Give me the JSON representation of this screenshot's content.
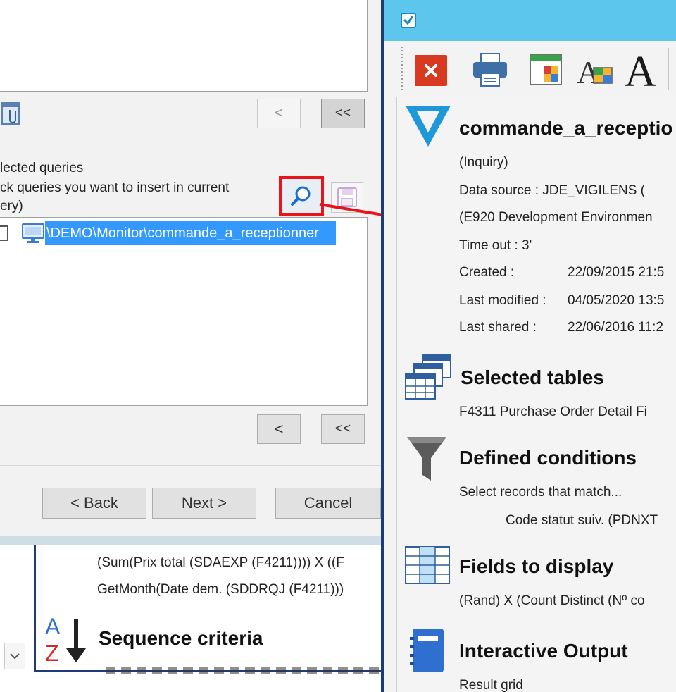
{
  "wizard": {
    "back_small": "<",
    "back_all": "<<",
    "section_title": "lected queries",
    "section_desc_line1": "ck queries you want to insert in current",
    "section_desc_line2": "ery)",
    "query_path": "\\DEMO\\Monitor\\commande_a_receptionner",
    "nav_back_small": "<",
    "nav_back_all": "<<",
    "back_button": "< Back",
    "next_button": "Next >",
    "cancel_button": "Cancel"
  },
  "behind_panel": {
    "line1": "(Sum(Prix total (SDAEXP (F4211)))) X ((F",
    "line2": "GetMonth(Date dem. (SDDRQJ (F4211)))",
    "sequence_heading": "Sequence criteria"
  },
  "report": {
    "query_title": "commande_a_receptio",
    "type": "(Inquiry)",
    "data_source": "Data source : JDE_VIGILENS   (",
    "environment": "(E920 Development Environmen",
    "timeout": "Time out : 3'",
    "created_label": "Created :",
    "created_value": "22/09/2015 21:5",
    "modified_label": "Last modified :",
    "modified_value": "04/05/2020 13:5",
    "shared_label": "Last shared :",
    "shared_value": "22/06/2016 11:2",
    "selected_tables_heading": "Selected tables",
    "selected_tables_value": "F4311  Purchase Order Detail Fi",
    "conditions_heading": "Defined conditions",
    "conditions_line1": "Select records that match...",
    "conditions_line2": "Code statut suiv. (PDNXT",
    "fields_heading": "Fields to display",
    "fields_value": "(Rand) X (Count Distinct (Nº co",
    "output_heading": "Interactive Output",
    "output_value": "Result grid"
  },
  "colors": {
    "title_bar": "#5dc6ec",
    "highlight": "#3399ff",
    "annotation_red": "#e8141a",
    "logo_blue": "#1e98d8"
  }
}
